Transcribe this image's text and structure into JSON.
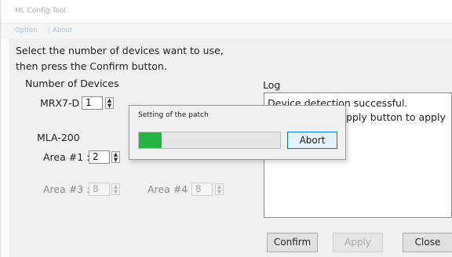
{
  "window": {
    "title": "ML Config Tool"
  },
  "menu": {
    "items": [
      {
        "label": "Option"
      },
      {
        "label": "About"
      }
    ]
  },
  "instructions": {
    "line1": "Select the number of devices want to use,",
    "line2": "then press the Confirm button."
  },
  "devices": {
    "section_label": "Number of Devices",
    "mrx7d": {
      "label": "MRX7-D :",
      "value": "1"
    },
    "mla200": {
      "label": "MLA-200",
      "area1": {
        "label": "Area #1 :",
        "value": "2"
      },
      "area3": {
        "label": "Area #3 :",
        "value": "8"
      },
      "area4": {
        "label": "Area #4 :",
        "value": "8"
      }
    }
  },
  "log": {
    "label": "Log",
    "line1": "Device detection successful.",
    "line2": "pply button to apply"
  },
  "buttons": {
    "confirm": "Confirm",
    "apply": "Apply",
    "close": "Close"
  },
  "dialog": {
    "title": "Setting of the patch",
    "progress": 0.16,
    "abort_label": "Abort",
    "progress_color": "#28b445"
  },
  "colors": {
    "accent": "#0078d7",
    "panel": "#f0f0f0"
  }
}
